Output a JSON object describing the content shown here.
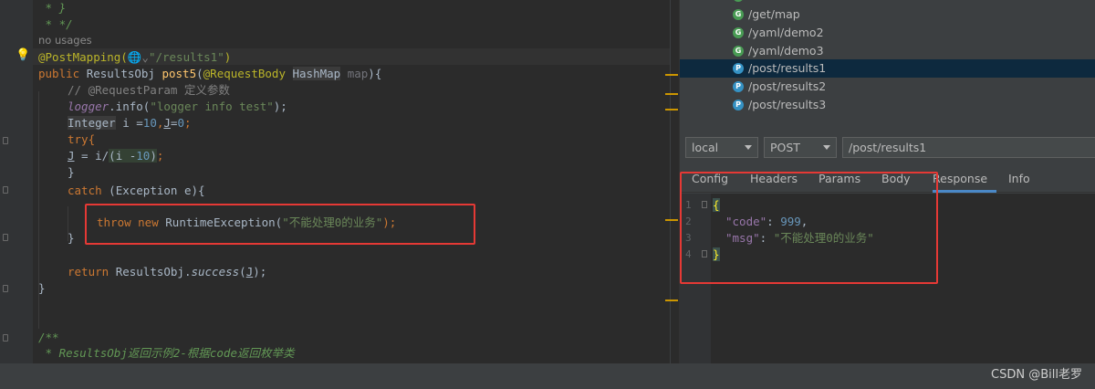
{
  "editor": {
    "lines": {
      "l1": " * }",
      "l2": " * */",
      "usage_hint": "no usages",
      "ann_name": "@PostMapping(",
      "ann_icon": "🌐",
      "ann_chevron": "⌄",
      "ann_path": "\"/results1\"",
      "ann_close": ")",
      "sig_public": "public ",
      "sig_type": "ResultsObj ",
      "sig_name": "post5",
      "sig_open": "(",
      "sig_ann": "@RequestBody ",
      "sig_ptype": "HashMap",
      "sig_pname": " map",
      "sig_close": "){",
      "cmt": "// @RequestParam 定义参数",
      "log_obj": "logger",
      "log_call": ".info(",
      "log_str": "\"logger info test\"",
      "log_end": ");",
      "int_type": "Integer",
      "int_rest1": " i =",
      "int_num": "10",
      "int_rest2": ",",
      "int_j": "J",
      "int_rest3": "=",
      "int_zero": "0",
      "int_end": ";",
      "try": "try{",
      "jassign_j": "J",
      "jassign_mid": " = i/",
      "jassign_paren": "(i -",
      "jassign_num": "10",
      "jassign_close": ")",
      "jassign_end": ";",
      "try_close": "}",
      "catch_kw": "catch",
      "catch_rest": " (Exception e){",
      "throw_kw": "throw new ",
      "throw_cls": "RuntimeException(",
      "throw_str": "\"不能处理0的业务\"",
      "throw_end": ");",
      "catch_close": "}",
      "ret_kw": "return ",
      "ret_cls": "ResultsObj.",
      "ret_fn": "success",
      "ret_open": "(",
      "ret_j": "J",
      "ret_end": ");",
      "method_close": "}",
      "doc_open": "/**",
      "doc_line": " * ResultsObj返回示例2-根据code返回枚举类"
    }
  },
  "endpoints": [
    {
      "method": "G",
      "path": "/get/map"
    },
    {
      "method": "G",
      "path": "/yaml/demo2"
    },
    {
      "method": "G",
      "path": "/yaml/demo3"
    },
    {
      "method": "P",
      "path": "/post/results1"
    },
    {
      "method": "P",
      "path": "/post/results2"
    },
    {
      "method": "P",
      "path": "/post/results3"
    }
  ],
  "request": {
    "env": "local",
    "method": "POST",
    "url": "/post/results1"
  },
  "tabs": [
    "Config",
    "Headers",
    "Params",
    "Body",
    "Response",
    "Info"
  ],
  "response": {
    "line_numbers": [
      "1",
      "2",
      "3",
      "4"
    ],
    "open": "{",
    "code_key": "\"code\"",
    "colon1": ": ",
    "code_val": "999",
    "comma": ",",
    "msg_key": "\"msg\"",
    "colon2": ": ",
    "msg_val": "\"不能处理0的业务\"",
    "close": "}"
  },
  "watermark": "CSDN @Bill老罗"
}
